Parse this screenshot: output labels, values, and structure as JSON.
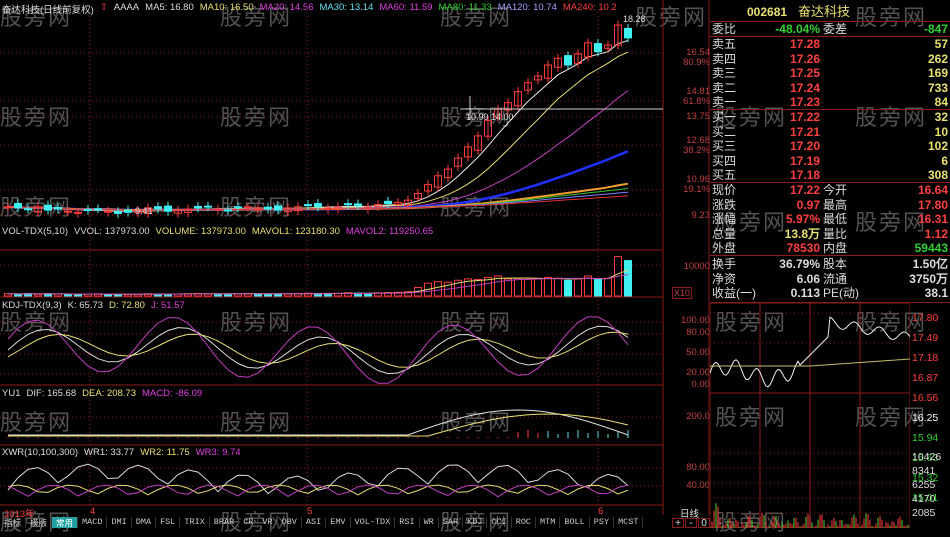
{
  "main": {
    "title": "奋达科技(日线前复权)",
    "code_tag": "AAAA",
    "ma": [
      "MA5: 16.80",
      "MA10: 16.50",
      "MA20: 14.56",
      "MA30: 13.14",
      "MA60: 11.59",
      "MA80: 11.33",
      "MA120: 10.74",
      "MA240: 10.2"
    ],
    "high_label": "18.28",
    "cross_label": "10.99 14.00",
    "low_label": "9.41",
    "axis": [
      "16.54",
      "80.9%",
      "14.81",
      "61.8%",
      "13.75",
      "12.68",
      "38.2%",
      "10.96",
      "19.1%",
      "9.23"
    ],
    "closes": [
      9.6,
      9.55,
      9.5,
      9.6,
      9.45,
      9.5,
      9.4,
      9.35,
      9.45,
      9.5,
      9.4,
      9.3,
      9.35,
      9.45,
      9.55,
      9.5,
      9.4,
      9.45,
      9.5,
      9.55,
      9.6,
      9.5,
      9.45,
      9.55,
      9.6,
      9.55,
      9.5,
      9.45,
      9.55,
      9.6,
      9.65,
      9.6,
      9.55,
      9.6,
      9.7,
      9.65,
      9.6,
      9.7,
      9.75,
      9.8,
      9.9,
      10.2,
      10.6,
      11.0,
      11.3,
      11.8,
      12.3,
      12.8,
      13.5,
      14.0,
      14.3,
      14.8,
      15.2,
      15.5,
      16.0,
      16.3,
      16.0,
      16.5,
      17.0,
      16.6,
      16.9,
      17.8,
      17.22
    ]
  },
  "volume": {
    "name": "VOL-TDX(5,10)",
    "vvol": "VVOL: 137973.00",
    "volume": "VOLUME: 137973.00",
    "mavol1": "MAVOL1: 123180.30",
    "mavol2": "MAVOL2: 119250.65",
    "axis": [
      "10000",
      "X10"
    ],
    "values": [
      8,
      7,
      9,
      6,
      8,
      7,
      6,
      5,
      7,
      8,
      6,
      5,
      6,
      7,
      8,
      7,
      6,
      7,
      8,
      9,
      8,
      7,
      6,
      8,
      9,
      8,
      7,
      6,
      8,
      9,
      10,
      9,
      8,
      9,
      11,
      10,
      9,
      11,
      12,
      13,
      15,
      30,
      45,
      50,
      48,
      55,
      60,
      58,
      65,
      70,
      60,
      62,
      58,
      60,
      65,
      62,
      55,
      60,
      70,
      58,
      62,
      138,
      124
    ]
  },
  "kdj": {
    "name": "KDJ-TDX(9,3)",
    "k": "K: 65.73",
    "d": "D: 72.80",
    "j": "J: 51.57",
    "axis": [
      "100.00",
      "80.00",
      "50.00",
      "20.00",
      "0.00"
    ]
  },
  "macd": {
    "name": "YU1",
    "dif": "DIF: 165.68",
    "dea": "DEA: 208.73",
    "macd": "MACD: -86.09",
    "axis": [
      "200.0"
    ]
  },
  "wr": {
    "name": "XWR(10,100,300)",
    "wr1": "WR1: 33.77",
    "wr2": "WR2: 11.75",
    "wr3": "WR3: 9.74",
    "axis": [
      "80.00",
      "40.00"
    ]
  },
  "dates": [
    "2013年",
    "4",
    "5",
    "6"
  ],
  "tabs": [
    "指标",
    "模版",
    "常用",
    "MACD",
    "DMI",
    "DMA",
    "FSL",
    "TRIX",
    "BRAR",
    "CR",
    "VR",
    "OBV",
    "ASI",
    "EMV",
    "VOL-TDX",
    "RSI",
    "WR",
    "SAR",
    "KDJ",
    "CCI",
    "ROC",
    "MTM",
    "BOLL",
    "PSY",
    "MCST"
  ],
  "quote": {
    "code": "002681",
    "name": "奋达科技",
    "wb_label": "委比",
    "wb": "-48.04%",
    "wc_label": "委差",
    "wc": "-847",
    "sells": [
      {
        "label": "卖五",
        "price": "17.28",
        "vol": "57"
      },
      {
        "label": "卖四",
        "price": "17.26",
        "vol": "262"
      },
      {
        "label": "卖三",
        "price": "17.25",
        "vol": "169"
      },
      {
        "label": "卖二",
        "price": "17.24",
        "vol": "733"
      },
      {
        "label": "卖一",
        "price": "17.23",
        "vol": "84"
      }
    ],
    "buys": [
      {
        "label": "买一",
        "price": "17.22",
        "vol": "32"
      },
      {
        "label": "买二",
        "price": "17.21",
        "vol": "10"
      },
      {
        "label": "买三",
        "price": "17.20",
        "vol": "102"
      },
      {
        "label": "买四",
        "price": "17.19",
        "vol": "6"
      },
      {
        "label": "买五",
        "price": "17.18",
        "vol": "308"
      }
    ],
    "stats": [
      {
        "l1": "现价",
        "v1": "17.22",
        "l2": "今开",
        "v2": "16.64",
        "c1": "#ff4040",
        "c2": "#ff4040"
      },
      {
        "l1": "涨跌",
        "v1": "0.97",
        "l2": "最高",
        "v2": "17.80",
        "c1": "#ff4040",
        "c2": "#ff4040"
      },
      {
        "l1": "涨幅",
        "v1": "5.97%",
        "l2": "最低",
        "v2": "16.31",
        "c1": "#ff4040",
        "c2": "#ff4040"
      },
      {
        "l1": "总量",
        "v1": "13.8万",
        "l2": "量比",
        "v2": "1.12",
        "c1": "#e8e070",
        "c2": "#ff4040"
      },
      {
        "l1": "外盘",
        "v1": "78530",
        "l2": "内盘",
        "v2": "59443",
        "c1": "#ff4040",
        "c2": "#30d030"
      },
      {
        "l1": "换手",
        "v1": "36.79%",
        "l2": "股本",
        "v2": "1.50亿",
        "c1": "#ddd",
        "c2": "#ddd"
      },
      {
        "l1": "净资",
        "v1": "6.06",
        "l2": "流通",
        "v2": "3750万",
        "c1": "#ddd",
        "c2": "#ddd"
      },
      {
        "l1": "收益(一)",
        "v1": "0.113",
        "l2": "PE(动)",
        "v2": "38.1",
        "c1": "#ddd",
        "c2": "#ddd"
      }
    ]
  },
  "intraday": {
    "prices_up": [
      "17.80",
      "17.49",
      "17.18",
      "16.87",
      "16.56"
    ],
    "prev_close": "16.25",
    "prices_down": [
      "15.94",
      "15.63",
      "15.32",
      "15.01"
    ],
    "volumes": [
      "10426",
      "8341",
      "6255",
      "4170",
      "2085"
    ],
    "period": "日线",
    "plus": "+",
    "minus": "-",
    "zero": "0"
  },
  "colors": {
    "up": "#ff3c3c",
    "down": "#40f0f0",
    "grid": "#8b1a1a"
  },
  "watermark": "股旁网"
}
